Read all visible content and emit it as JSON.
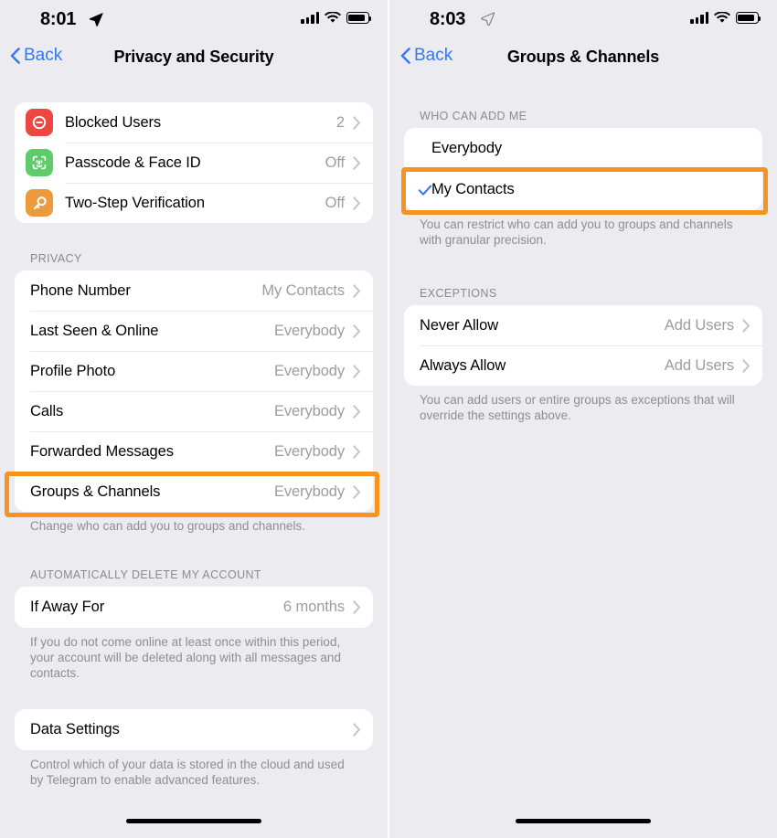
{
  "colors": {
    "page_background": "#ecebf0",
    "card_background": "#ffffff",
    "accent_blue": "#3478f6",
    "highlight_orange": "#f7931e",
    "value_gray": "#9c9ca1",
    "icon_red": "#ec4840",
    "icon_green": "#5fcc6a",
    "icon_orange": "#ed9a3c"
  },
  "left_screen": {
    "status_bar": {
      "time": "8:01",
      "location_icon": "location-arrow-icon",
      "cellular_icon": "cellular-bars-icon",
      "wifi_icon": "wifi-icon",
      "battery_icon": "battery-icon"
    },
    "nav": {
      "back_label": "Back",
      "title": "Privacy and Security"
    },
    "security_section": {
      "rows": [
        {
          "icon": "block-user-icon",
          "label": "Blocked Users",
          "value": "2"
        },
        {
          "icon": "face-id-icon",
          "label": "Passcode & Face ID",
          "value": "Off"
        },
        {
          "icon": "key-icon",
          "label": "Two-Step Verification",
          "value": "Off"
        }
      ]
    },
    "privacy_section": {
      "header": "PRIVACY",
      "rows": [
        {
          "label": "Phone Number",
          "value": "My Contacts"
        },
        {
          "label": "Last Seen & Online",
          "value": "Everybody"
        },
        {
          "label": "Profile Photo",
          "value": "Everybody"
        },
        {
          "label": "Calls",
          "value": "Everybody"
        },
        {
          "label": "Forwarded Messages",
          "value": "Everybody"
        },
        {
          "label": "Groups & Channels",
          "value": "Everybody"
        }
      ],
      "footer": "Change who can add you to groups and channels."
    },
    "auto_delete_section": {
      "header": "AUTOMATICALLY DELETE MY ACCOUNT",
      "rows": [
        {
          "label": "If Away For",
          "value": "6 months"
        }
      ],
      "footer": "If you do not come online at least once within this period, your account will be deleted along with all messages and contacts."
    },
    "data_section": {
      "rows": [
        {
          "label": "Data Settings",
          "value": ""
        }
      ],
      "footer": "Control which of your data is stored in the cloud and used by Telegram to enable advanced features."
    }
  },
  "right_screen": {
    "status_bar": {
      "time": "8:03",
      "location_icon": "location-arrow-icon",
      "cellular_icon": "cellular-bars-icon",
      "wifi_icon": "wifi-icon",
      "battery_icon": "battery-icon"
    },
    "nav": {
      "back_label": "Back",
      "title": "Groups & Channels"
    },
    "who_can_add_section": {
      "header": "WHO CAN ADD ME",
      "options": [
        {
          "label": "Everybody",
          "selected": false
        },
        {
          "label": "My Contacts",
          "selected": true
        }
      ],
      "footer": "You can restrict who can add you to groups and channels with granular precision."
    },
    "exceptions_section": {
      "header": "EXCEPTIONS",
      "rows": [
        {
          "label": "Never Allow",
          "value": "Add Users"
        },
        {
          "label": "Always Allow",
          "value": "Add Users"
        }
      ],
      "footer": "You can add users or entire groups as exceptions that will override the settings above."
    }
  }
}
